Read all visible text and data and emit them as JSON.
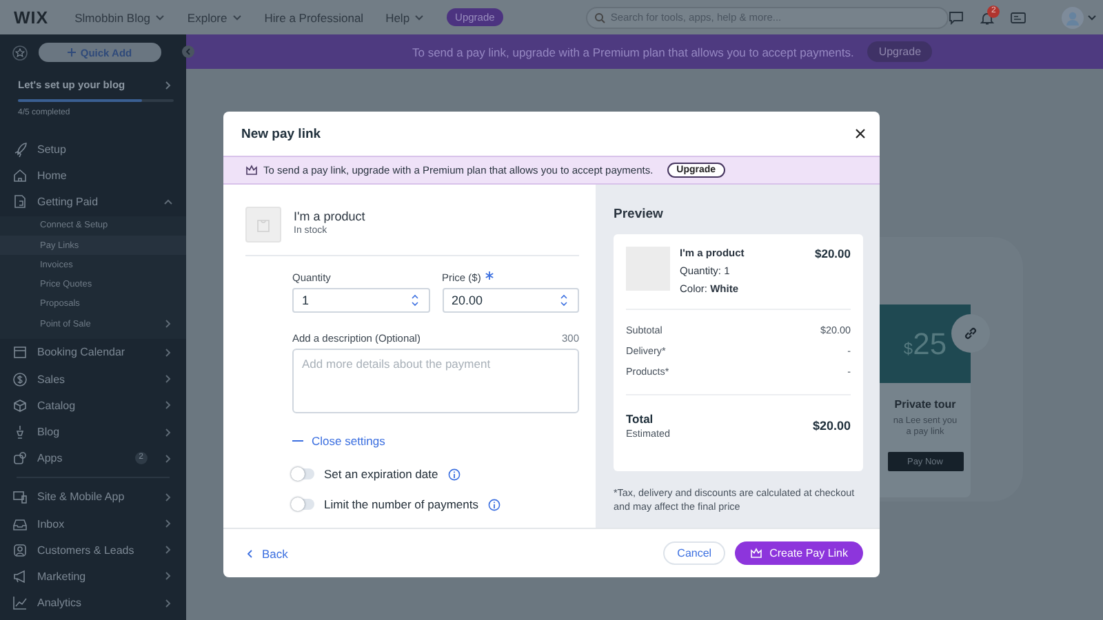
{
  "topbar": {
    "logo": "WIX",
    "site_name": "Slmobbin Blog",
    "nav": [
      "Explore",
      "Hire a Professional",
      "Help"
    ],
    "upgrade": "Upgrade",
    "search": {
      "placeholder": "Search for tools, apps, help & more..."
    },
    "notification_count": "2"
  },
  "banner": {
    "text": "To send a pay link, upgrade with a Premium plan that allows you to accept payments.",
    "button": "Upgrade"
  },
  "sidebar": {
    "quick_add": "Quick Add",
    "setup": {
      "title": "Let's set up your blog",
      "level": 0.8,
      "status": "4/5 completed"
    },
    "sections": [
      [
        {
          "label": "Setup",
          "expandable": false,
          "expanded": false,
          "selected": false
        },
        {
          "label": "Home",
          "expandable": false,
          "expanded": false,
          "selected": false
        },
        {
          "label": "Getting Paid",
          "expandable": true,
          "expanded": true,
          "selected": false,
          "children": [
            {
              "label": "Connect & Setup",
              "expandable": false,
              "selected": false
            },
            {
              "label": "Pay Links",
              "expandable": false,
              "selected": true
            },
            {
              "label": "Invoices",
              "expandable": false,
              "selected": false
            },
            {
              "label": "Price Quotes",
              "expandable": false,
              "selected": false
            },
            {
              "label": "Proposals",
              "expandable": false,
              "selected": false
            },
            {
              "label": "Point of Sale",
              "expandable": true,
              "selected": false
            }
          ]
        },
        {
          "label": "Booking Calendar",
          "expandable": true,
          "expanded": false,
          "selected": false
        },
        {
          "label": "Sales",
          "expandable": true,
          "expanded": false,
          "selected": false
        },
        {
          "label": "Catalog",
          "expandable": true,
          "expanded": false,
          "selected": false
        },
        {
          "label": "Blog",
          "expandable": true,
          "expanded": false,
          "selected": false
        },
        {
          "label": "Apps",
          "expandable": true,
          "expanded": false,
          "selected": false,
          "badge": "2"
        }
      ],
      [
        {
          "label": "Site & Mobile App",
          "expandable": true,
          "expanded": false,
          "selected": false
        },
        {
          "label": "Inbox",
          "expandable": true,
          "expanded": false,
          "selected": false
        },
        {
          "label": "Customers & Leads",
          "expandable": true,
          "expanded": false,
          "selected": false
        },
        {
          "label": "Marketing",
          "expandable": true,
          "expanded": false,
          "selected": false
        },
        {
          "label": "Analytics",
          "expandable": true,
          "expanded": false,
          "selected": false
        }
      ]
    ]
  },
  "background_card": {
    "currency": "$",
    "price": "25",
    "title": "Private tour",
    "message": "na Lee sent you a pay link",
    "button": "Pay Now"
  },
  "modal": {
    "title": "New pay link",
    "notice": {
      "text": "To send a pay link, upgrade with a Premium plan that allows you to accept payments.",
      "button": "Upgrade"
    },
    "product": {
      "name": "I'm a product",
      "stock": "In stock"
    },
    "quantity": {
      "label": "Quantity",
      "value": "1"
    },
    "price": {
      "label": "Price ($)",
      "required": true,
      "value": "20.00"
    },
    "description": {
      "label": "Add a description (Optional)",
      "counter": "300",
      "placeholder": "Add more details about the payment"
    },
    "settings_link": "Close settings",
    "toggles": [
      {
        "label": "Set an expiration date",
        "on": false
      },
      {
        "label": "Limit the number of payments",
        "on": false
      }
    ],
    "back": "Back",
    "cancel": "Cancel",
    "create": "Create Pay Link",
    "preview": {
      "title": "Preview",
      "item": {
        "name": "I'm a product",
        "price": "$20.00",
        "quantity": "Quantity: 1",
        "variant": "Color: **White**"
      },
      "summary": [
        {
          "label": "Subtotal",
          "value": "$20.00"
        },
        {
          "label": "Delivery*",
          "value": "-"
        },
        {
          "label": "Products*",
          "value": "-"
        }
      ],
      "total": {
        "label": "Total",
        "note": "Estimated",
        "value": "$20.00"
      },
      "footnote": "*Tax, delivery and discounts are calculated at checkout and may affect the final price"
    }
  }
}
